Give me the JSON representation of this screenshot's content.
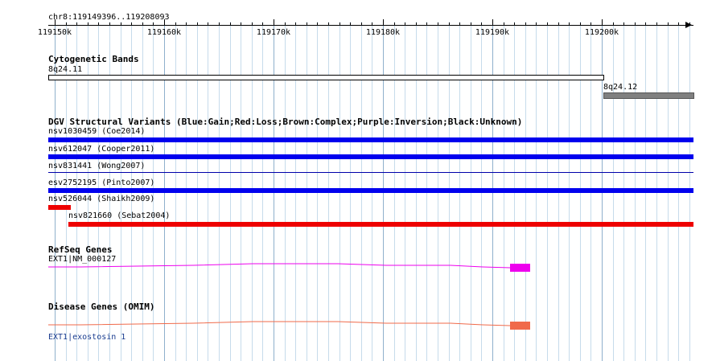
{
  "ruler": {
    "location": "chr8:119149396..119208093",
    "ticks": [
      "119150k",
      "119160k",
      "119170k",
      "119180k",
      "119190k",
      "119200k"
    ]
  },
  "cytoband": {
    "title": "Cytogenetic Bands",
    "band1_label": "8q24.11",
    "band2_label": "8q24.12",
    "colors": {
      "band1": "#ffffff",
      "band2": "#808080"
    }
  },
  "dgv": {
    "title": "DGV Structural Variants (Blue:Gain;Red:Loss;Brown:Complex;Purple:Inversion;Black:Unknown)",
    "variants": [
      {
        "label": "nsv1030459 (Coe2014)",
        "type": "gain",
        "color": "#0000ee"
      },
      {
        "label": "nsv612047 (Cooper2011)",
        "type": "gain",
        "color": "#0000ee"
      },
      {
        "label": "nsv831441 (Wong2007)",
        "type": "gain",
        "color": "#0000aa"
      },
      {
        "label": "esv2752195 (Pinto2007)",
        "type": "gain",
        "color": "#0000ee"
      },
      {
        "label": "nsv526044 (Shaikh2009)",
        "type": "loss",
        "color": "#ee0000"
      },
      {
        "label": "nsv821660 (Sebat2004)",
        "type": "loss",
        "color": "#ee0000"
      }
    ]
  },
  "refseq": {
    "title": "RefSeq Genes",
    "gene_label": "EXT1|NM_000127",
    "color": "#ee00ee"
  },
  "omim": {
    "title": "Disease Genes (OMIM)",
    "gene_label": "EXT1|exostosin 1",
    "color": "#f06a4a"
  }
}
